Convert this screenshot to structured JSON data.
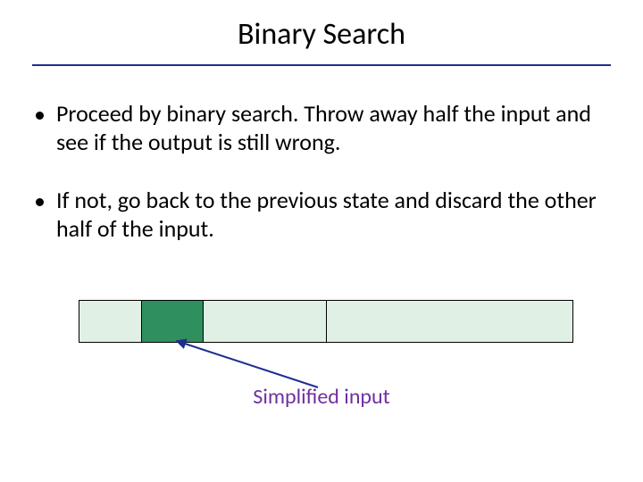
{
  "title": "Binary Search",
  "bullets": [
    "Proceed by binary search. Throw away half the input and see if the output is still wrong.",
    "If not, go back to the previous state and discard the other half of the input."
  ],
  "caption": "Simplified input",
  "diagram": {
    "bar_color": "#e0f0e4",
    "highlight_color": "#2f8f5f",
    "segment_fracs": [
      0.125,
      0.25,
      0.5
    ],
    "highlight_start_frac": 0.125,
    "highlight_end_frac": 0.25
  },
  "accent_rule_color": "#1f2f8f",
  "caption_color": "#7030a0",
  "arrow_color": "#1f2f8f"
}
